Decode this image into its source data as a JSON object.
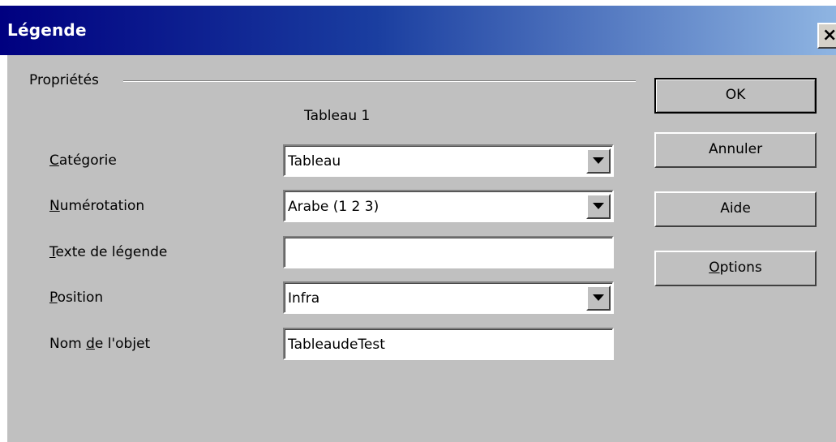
{
  "window": {
    "title": "Légende",
    "close_symbol": "×"
  },
  "group": {
    "label": "Propriétés"
  },
  "object_title": "Tableau 1",
  "fields": [
    {
      "label_prefix": "",
      "label_mnemonic": "C",
      "label_rest": "atégorie",
      "type": "dropdown",
      "value": "Tableau"
    },
    {
      "label_prefix": "",
      "label_mnemonic": "N",
      "label_rest": "umérotation",
      "type": "dropdown",
      "value": "Arabe (1 2 3)"
    },
    {
      "label_prefix": "",
      "label_mnemonic": "T",
      "label_rest": "exte de légende",
      "type": "text",
      "value": ""
    },
    {
      "label_prefix": "",
      "label_mnemonic": "P",
      "label_rest": "osition",
      "type": "dropdown",
      "value": "Infra"
    },
    {
      "label_prefix": "Nom ",
      "label_mnemonic": "d",
      "label_rest": "e l'objet",
      "type": "text",
      "value": "TableaudeTest"
    }
  ],
  "buttons": {
    "ok": "OK",
    "cancel": "Annuler",
    "help": "Aide",
    "options_mnemonic": "O",
    "options_rest": "ptions"
  },
  "icons": {
    "close": "close-icon",
    "dropdown": "chevron-down-icon"
  },
  "colors": {
    "title_gradient_start": "#000080",
    "title_gradient_end": "#8fb5e2",
    "dialog_bg": "#c0c0c0"
  }
}
